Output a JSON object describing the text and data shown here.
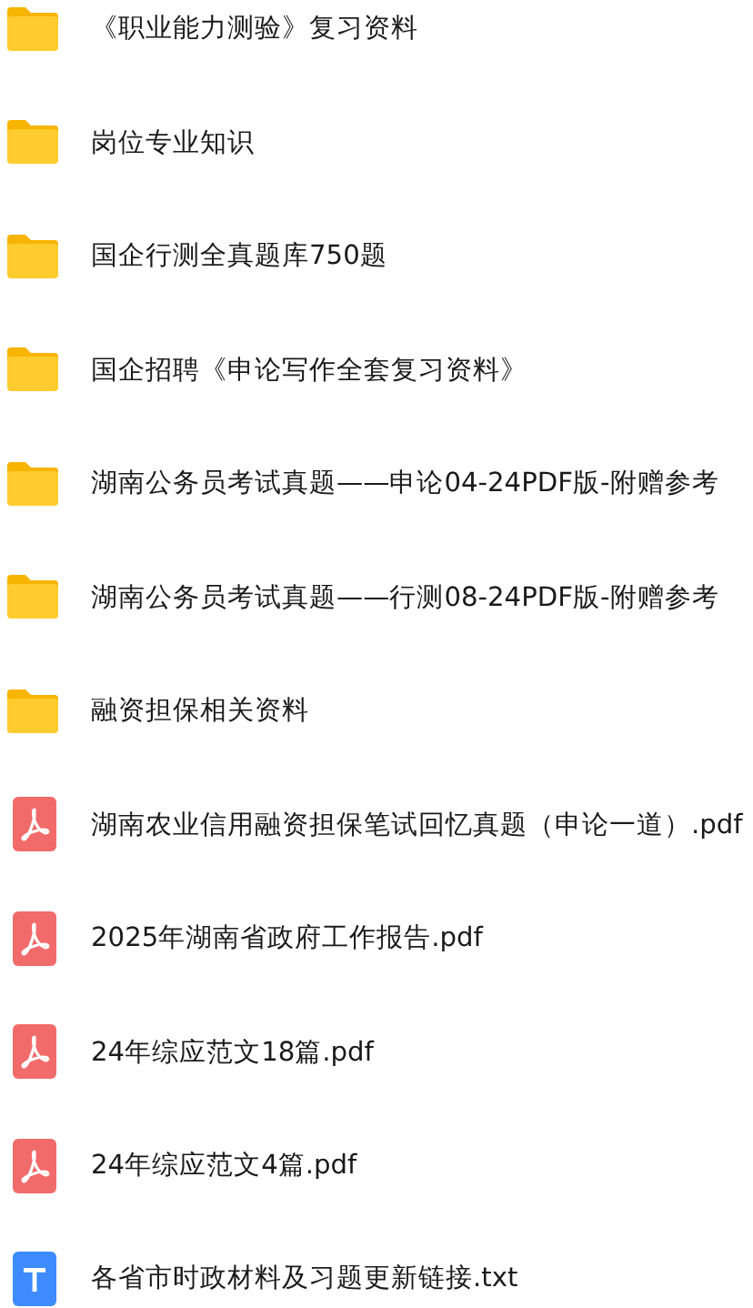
{
  "files": [
    {
      "kind": "folder",
      "name": "《职业能力测验》复习资料"
    },
    {
      "kind": "folder",
      "name": "岗位专业知识"
    },
    {
      "kind": "folder",
      "name": "国企行测全真题库750题"
    },
    {
      "kind": "folder",
      "name": "国企招聘《申论写作全套复习资料》"
    },
    {
      "kind": "folder",
      "name": "湖南公务员考试真题——申论04-24PDF版-附赠参考"
    },
    {
      "kind": "folder",
      "name": "湖南公务员考试真题——行测08-24PDF版-附赠参考"
    },
    {
      "kind": "folder",
      "name": "融资担保相关资料"
    },
    {
      "kind": "pdf",
      "name": "湖南农业信用融资担保笔试回忆真题（申论一道）.pdf"
    },
    {
      "kind": "pdf",
      "name": "2025年湖南省政府工作报告.pdf"
    },
    {
      "kind": "pdf",
      "name": "24年综应范文18篇.pdf"
    },
    {
      "kind": "pdf",
      "name": "24年综应范文4篇.pdf"
    },
    {
      "kind": "txt",
      "name": "各省市时政材料及习题更新链接.txt"
    }
  ]
}
